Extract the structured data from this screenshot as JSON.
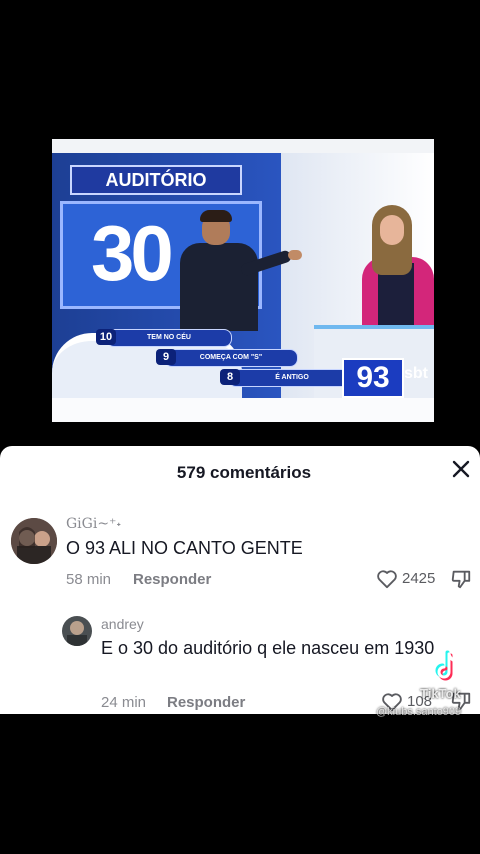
{
  "video": {
    "auditorio_label": "AUDITÓRIO",
    "auditorio_number": "30",
    "clues": [
      {
        "number": "10",
        "text": "TEM NO CÉU"
      },
      {
        "number": "9",
        "text": "COMEÇA COM \"S\""
      },
      {
        "number": "8",
        "text": "É ANTIGO"
      }
    ],
    "score": "93",
    "channel_logo": "sbt"
  },
  "comments_sheet": {
    "title": "579 comentários",
    "close_icon": "close-icon",
    "comments": [
      {
        "username": "GiGi~⁺˖",
        "text": "O 93 ALI NO CANTO GENTE",
        "time": "58 min",
        "reply_label": "Responder",
        "likes": "2425"
      }
    ],
    "replies": [
      {
        "username": "andrey",
        "text": "E o 30 do auditório q ele nasceu em 1930",
        "time": "24 min",
        "reply_label": "Responder",
        "likes": "108"
      }
    ]
  },
  "watermark": {
    "brand": "TikTok",
    "handle": "@kiubs.santo909"
  }
}
